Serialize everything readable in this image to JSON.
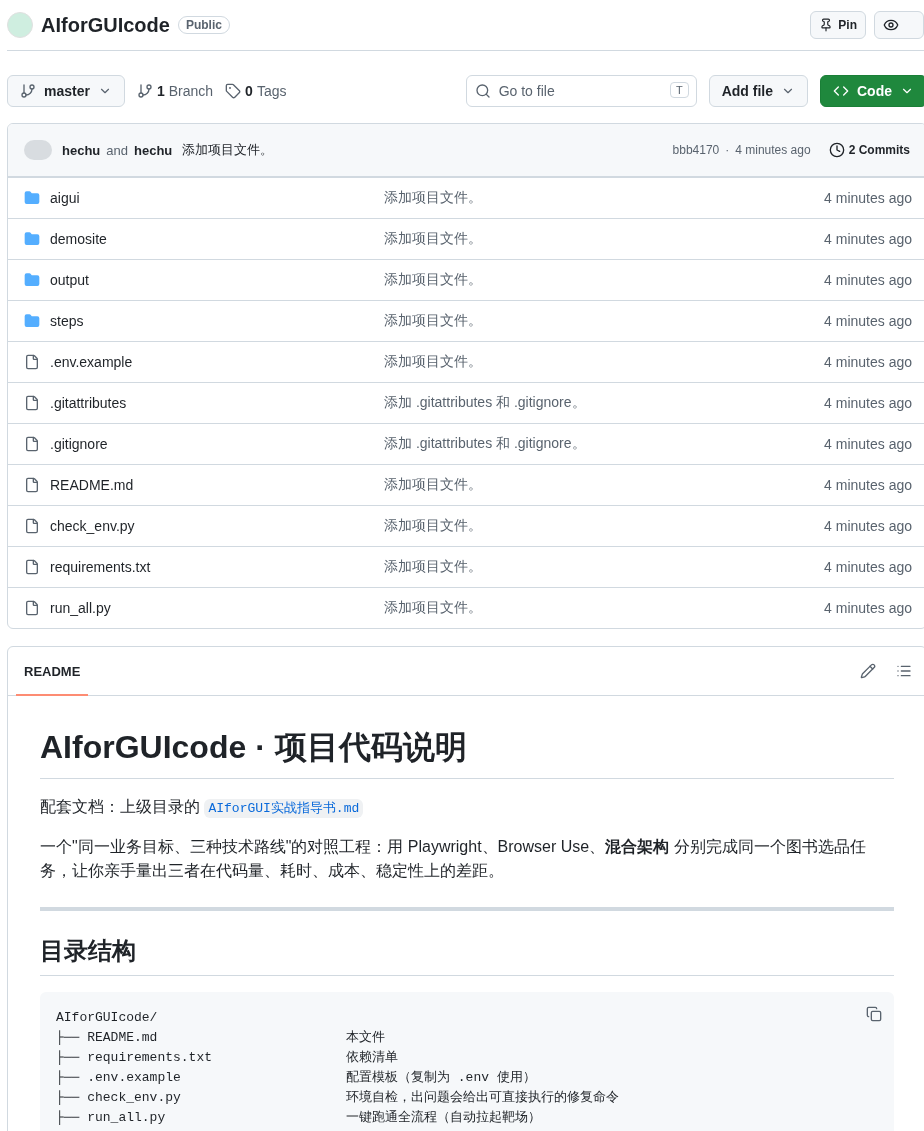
{
  "repo": {
    "name": "AIforGUIcode",
    "visibility": "Public",
    "pin_label": "Pin"
  },
  "toolbar": {
    "branch": "master",
    "branches_count": "1",
    "branches_label": "Branch",
    "tags_count": "0",
    "tags_label": "Tags",
    "search_placeholder": "Go to file",
    "search_key": "T",
    "add_file": "Add file",
    "code": "Code"
  },
  "commit": {
    "author1": "hechu",
    "joiner": "and",
    "author2": "hechu",
    "message": "添加项目文件。",
    "hash": "bbb4170",
    "separator": "·",
    "time": "4 minutes ago",
    "commits": "2 Commits"
  },
  "files": [
    {
      "kind": "folder",
      "name": "aigui",
      "message": "添加项目文件。",
      "time": "4 minutes ago"
    },
    {
      "kind": "folder",
      "name": "demosite",
      "message": "添加项目文件。",
      "time": "4 minutes ago"
    },
    {
      "kind": "folder",
      "name": "output",
      "message": "添加项目文件。",
      "time": "4 minutes ago"
    },
    {
      "kind": "folder",
      "name": "steps",
      "message": "添加项目文件。",
      "time": "4 minutes ago"
    },
    {
      "kind": "file",
      "name": ".env.example",
      "message": "添加项目文件。",
      "time": "4 minutes ago"
    },
    {
      "kind": "file",
      "name": ".gitattributes",
      "message": "添加 .gitattributes 和 .gitignore。",
      "time": "4 minutes ago"
    },
    {
      "kind": "file",
      "name": ".gitignore",
      "message": "添加 .gitattributes 和 .gitignore。",
      "time": "4 minutes ago"
    },
    {
      "kind": "file",
      "name": "README.md",
      "message": "添加项目文件。",
      "time": "4 minutes ago"
    },
    {
      "kind": "file",
      "name": "check_env.py",
      "message": "添加项目文件。",
      "time": "4 minutes ago"
    },
    {
      "kind": "file",
      "name": "requirements.txt",
      "message": "添加项目文件。",
      "time": "4 minutes ago"
    },
    {
      "kind": "file",
      "name": "run_all.py",
      "message": "添加项目文件。",
      "time": "4 minutes ago"
    }
  ],
  "readme": {
    "tab": "README",
    "title": "AIforGUIcode · 项目代码说明",
    "doc_prefix": "配套文档：上级目录的",
    "doc_link": "AIforGUI实战指导书.md",
    "intro": "一个\"同一业务目标、三种技术路线\"的对照工程：用 Playwright、Browser Use、**混合架构** 分别完成同一个图书选品任务，让你亲手量出三者在代码量、耗时、成本、稳定性上的差距。",
    "section": "目录结构",
    "code_lines": [
      {
        "path": "AIforGUIcode/"
      },
      {
        "path": "├── README.md",
        "note": "本文件"
      },
      {
        "path": "├── requirements.txt",
        "note": "依赖清单"
      },
      {
        "path": "├── .env.example",
        "note": "配置模板（复制为 .env 使用）"
      },
      {
        "path": "├── check_env.py",
        "note": "环境自检，出问题会给出可直接执行的修复命令"
      },
      {
        "path": "├── run_all.py",
        "note": "一键跑通全流程（自动拉起靶场）"
      }
    ]
  }
}
